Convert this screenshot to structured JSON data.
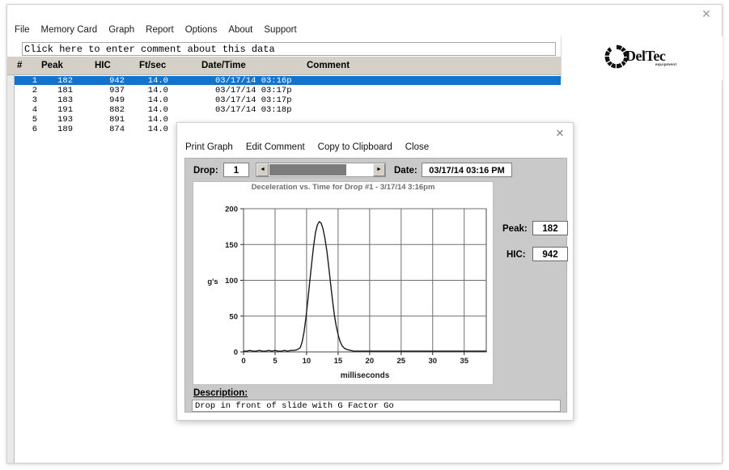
{
  "window": {
    "close_label": "✕"
  },
  "menubar": {
    "items": [
      {
        "label": "File"
      },
      {
        "label": "Memory Card"
      },
      {
        "label": "Graph"
      },
      {
        "label": "Report"
      },
      {
        "label": "Options"
      },
      {
        "label": "About"
      },
      {
        "label": "Support"
      }
    ]
  },
  "comment_bar": {
    "value": "Click here to enter comment about this data",
    "placeholder": "Click here to enter comment about this data"
  },
  "logo": {
    "name": "DelTec",
    "tagline": "equipment",
    "mark": "segmented-ring-icon"
  },
  "table": {
    "columns": [
      {
        "key": "num",
        "label": "#"
      },
      {
        "key": "peak",
        "label": "Peak"
      },
      {
        "key": "hic",
        "label": "HIC"
      },
      {
        "key": "ftsec",
        "label": "Ft/sec"
      },
      {
        "key": "datetime",
        "label": "Date/Time"
      },
      {
        "key": "comment",
        "label": "Comment"
      }
    ],
    "rows": [
      {
        "num": "1",
        "peak": "182",
        "hic": "942",
        "ftsec": "14.0",
        "datetime": "03/17/14 03:16p",
        "comment": "",
        "selected": true
      },
      {
        "num": "2",
        "peak": "181",
        "hic": "937",
        "ftsec": "14.0",
        "datetime": "03/17/14 03:17p",
        "comment": "",
        "selected": false
      },
      {
        "num": "3",
        "peak": "183",
        "hic": "949",
        "ftsec": "14.0",
        "datetime": "03/17/14 03:17p",
        "comment": "",
        "selected": false
      },
      {
        "num": "4",
        "peak": "191",
        "hic": "882",
        "ftsec": "14.0",
        "datetime": "03/17/14 03:18p",
        "comment": "",
        "selected": false
      },
      {
        "num": "5",
        "peak": "193",
        "hic": "891",
        "ftsec": "14.0",
        "datetime": "",
        "comment": "",
        "selected": false
      },
      {
        "num": "6",
        "peak": "189",
        "hic": "874",
        "ftsec": "14.0",
        "datetime": "",
        "comment": "",
        "selected": false
      }
    ]
  },
  "dialog": {
    "close_label": "✕",
    "menu": [
      {
        "label": "Print Graph"
      },
      {
        "label": "Edit Comment"
      },
      {
        "label": "Copy to Clipboard"
      },
      {
        "label": "Close"
      }
    ],
    "drop_label": "Drop:",
    "drop_value": "1",
    "scroll_left_icon": "◄",
    "scroll_right_icon": "►",
    "date_label": "Date:",
    "date_value": "03/17/14 03:16 PM",
    "peak_label": "Peak:",
    "peak_value": "182",
    "hic_label": "HIC:",
    "hic_value": "942",
    "description_label": "Description:",
    "description_value": "Drop in front of slide with G Factor Go"
  },
  "chart_data": {
    "type": "line",
    "title": "Deceleration vs. Time for Drop #1 - 3/17/14 3:16pm",
    "xlabel": "milliseconds",
    "ylabel": "g's",
    "xlim": [
      0,
      38.5
    ],
    "ylim": [
      0,
      200
    ],
    "xticks": [
      0,
      5,
      10,
      15,
      20,
      25,
      30,
      35
    ],
    "yticks": [
      0,
      50,
      100,
      150,
      200
    ],
    "grid": true,
    "legend": "none",
    "line_color": "#1a1a1a",
    "series": [
      {
        "name": "Deceleration",
        "x": [
          0,
          0.5,
          1,
          1.5,
          2,
          2.5,
          3,
          3.5,
          4,
          4.5,
          5,
          5.5,
          6,
          6.5,
          7,
          7.5,
          8,
          8.5,
          9,
          9.3,
          9.6,
          9.9,
          10.2,
          10.5,
          10.8,
          11.1,
          11.4,
          11.7,
          12,
          12.3,
          12.6,
          12.9,
          13.2,
          13.5,
          13.8,
          14.1,
          14.4,
          14.7,
          15,
          15.3,
          15.6,
          16,
          16.5,
          17,
          17.5,
          18,
          19,
          20,
          21,
          22,
          23,
          24,
          25,
          26,
          27,
          28,
          29,
          30,
          31,
          32,
          33,
          34,
          35,
          36,
          37,
          38,
          38.5
        ],
        "y": [
          1,
          1,
          2,
          1,
          1,
          2,
          1,
          1,
          2,
          1,
          2,
          1,
          1,
          2,
          1,
          2,
          2,
          3,
          6,
          14,
          28,
          48,
          72,
          98,
          123,
          147,
          166,
          177,
          182,
          180,
          172,
          159,
          142,
          120,
          96,
          73,
          52,
          36,
          24,
          15,
          9,
          5,
          3,
          2,
          1,
          1,
          1,
          1,
          1,
          1,
          1,
          1,
          1,
          1,
          1,
          1,
          1,
          1,
          1,
          1,
          1,
          1,
          1,
          1,
          1,
          1,
          1
        ]
      }
    ],
    "peak_value": 182,
    "peak_time_ms": 12
  }
}
